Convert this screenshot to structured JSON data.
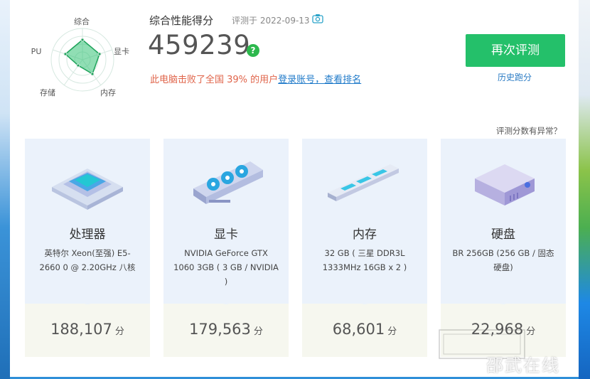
{
  "radar": {
    "labels": {
      "top": "综合",
      "right": "显卡",
      "bottom_right": "内存",
      "bottom_left": "存储",
      "left": "CPU"
    }
  },
  "header": {
    "title": "综合性能得分",
    "date_text": "评测于 2022-09-13",
    "total_score": "459239",
    "help_symbol": "?",
    "beat_text": "此电脑击败了全国 39% 的用户",
    "login_link": "登录账号，查看排名",
    "retest_label": "再次评测",
    "history_label": "历史跑分",
    "anomaly_label": "评测分数有异常？"
  },
  "cards": [
    {
      "name": "处理器",
      "desc": "英特尔 Xeon(至强) E5-2660 0 @ 2.20GHz 八核",
      "score": "188,107",
      "unit": "分",
      "icon": "cpu-chip-icon"
    },
    {
      "name": "显卡",
      "desc": "NVIDIA GeForce GTX 1060 3GB ( 3 GB / NVIDIA )",
      "score": "179,563",
      "unit": "分",
      "icon": "graphics-card-icon"
    },
    {
      "name": "内存",
      "desc": "32 GB ( 三星 DDR3L 1333MHz 16GB x 2 )",
      "score": "68,601",
      "unit": "分",
      "icon": "memory-stick-icon"
    },
    {
      "name": "硬盘",
      "desc": "BR 256GB (256 GB / 固态硬盘)",
      "score": "22,968",
      "unit": "分",
      "icon": "hard-drive-icon"
    }
  ],
  "watermark_text": "邵武在线",
  "colors": {
    "accent_green": "#24c06a",
    "link_blue": "#1f7ac9",
    "warning_orange": "#e0644a"
  }
}
